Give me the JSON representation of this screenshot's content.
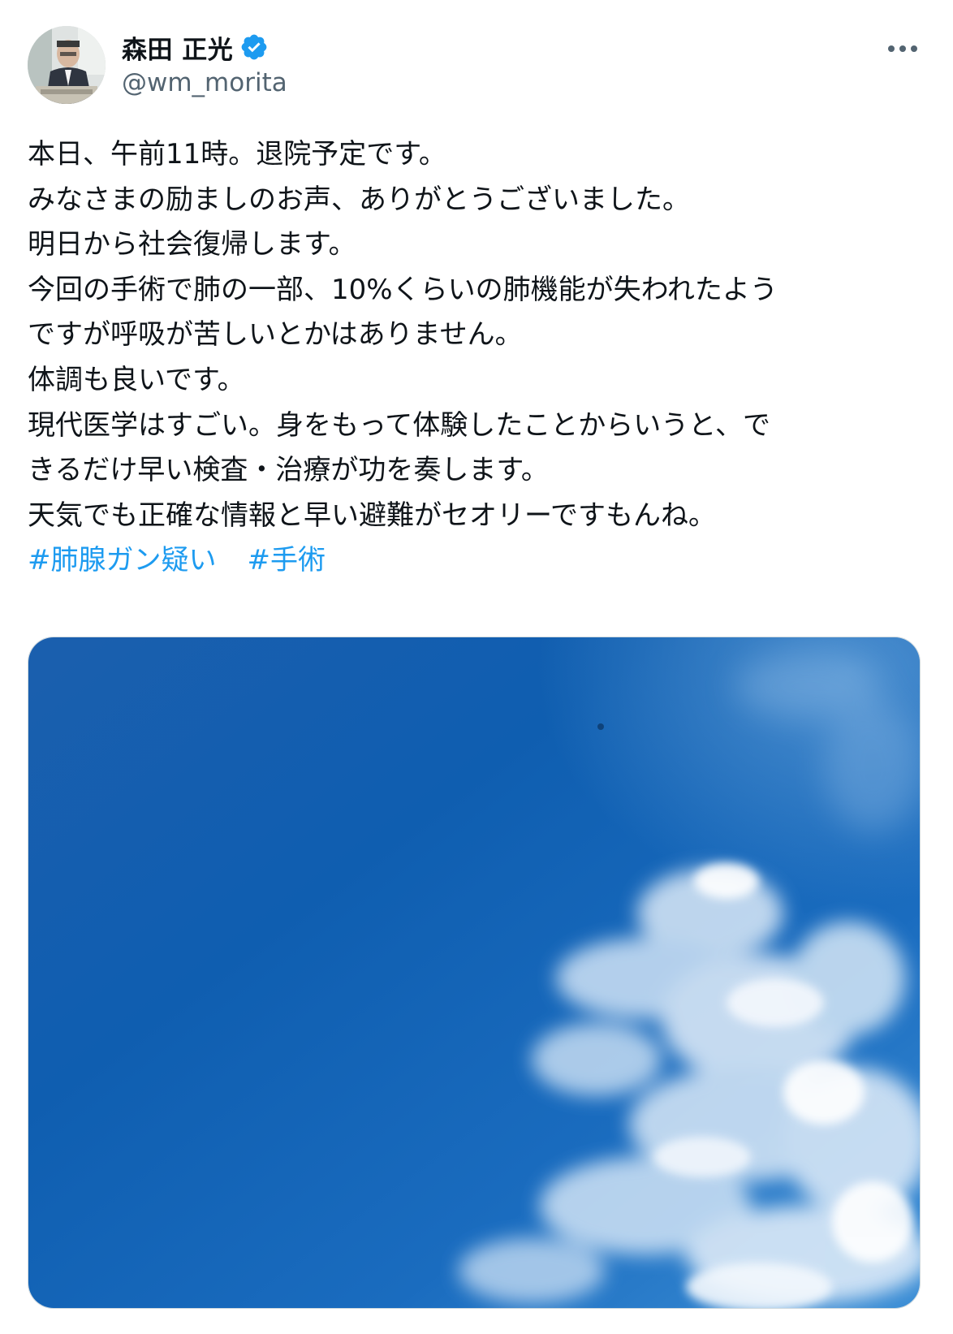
{
  "author": {
    "display_name": "森田 正光",
    "handle": "@wm_morita",
    "verified": true,
    "verified_color": "#1d9bf0"
  },
  "tweet": {
    "lines": [
      "本日、午前11時。退院予定です。",
      "みなさまの励ましのお声、ありがとうございました。",
      "明日から社会復帰します。",
      "今回の手術で肺の一部、10%くらいの肺機能が失われたよう",
      "ですが呼吸が苦しいとかはありません。",
      "体調も良いです。",
      "現代医学はすごい。身をもって体験したことからいうと、で",
      "きるだけ早い検査・治療が功を奏します。",
      "天気でも正確な情報と早い避難がセオリーですもんね。"
    ],
    "hashtags": [
      "#肺腺ガン疑い",
      "#手術"
    ],
    "hashtag_color": "#1d9bf0"
  },
  "media": {
    "icon": "photo-sky-clouds",
    "sky_color": "#1565b8"
  },
  "icons": {
    "more": "more-horizontal-icon",
    "verified": "verified-badge-icon"
  }
}
